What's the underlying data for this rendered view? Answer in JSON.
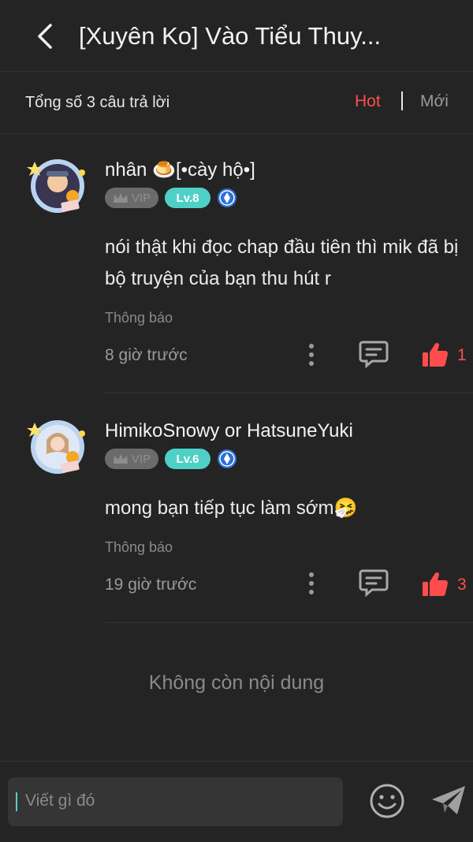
{
  "header": {
    "title": "[Xuyên Ko] Vào Tiểu Thuy..."
  },
  "subbar": {
    "total": "Tổng số 3 câu trả lời",
    "sort_hot": "Hot",
    "sort_new": "Mới"
  },
  "comments": [
    {
      "username": "nhân 🍮[•cày hộ•]",
      "vip": "VIP",
      "level": "Lv.8",
      "text": "nói thật khi đọc chap đầu tiên thì mik đã bị bộ truyện của bạn thu hút r",
      "notify": "Thông báo",
      "time": "8 giờ trước",
      "likes": "1"
    },
    {
      "username": "HimikoSnowy or HatsuneYuki",
      "vip": "VIP",
      "level": "Lv.6",
      "text": "mong bạn tiếp tục làm sớm🤧",
      "notify": "Thông báo",
      "time": "19 giờ trước",
      "likes": "3"
    }
  ],
  "end_text": "Không còn nội dung",
  "composer": {
    "placeholder": "Viết gì đó"
  },
  "colors": {
    "accent": "#ff4d4d",
    "level_badge": "#4fd0c7",
    "background": "#242424"
  }
}
